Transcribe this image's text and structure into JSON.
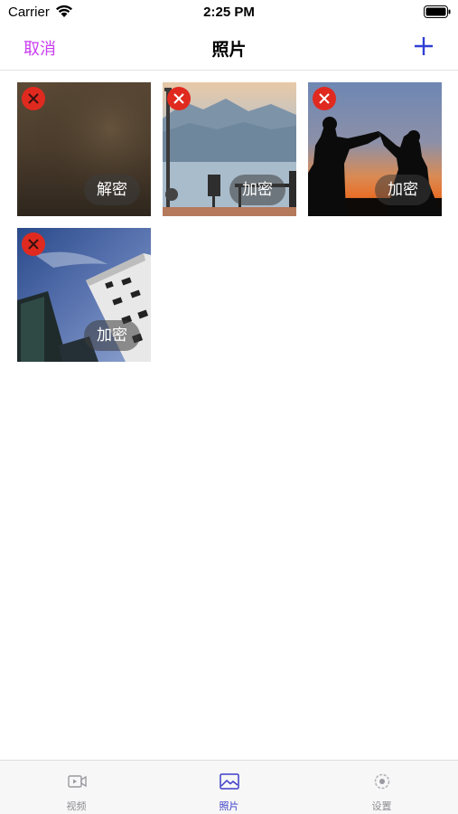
{
  "status_bar": {
    "carrier": "Carrier",
    "time": "2:25 PM"
  },
  "nav": {
    "cancel_label": "取消",
    "title": "照片",
    "accent_color": "#c93cf0",
    "add_color": "#2f3fd6"
  },
  "photos": [
    {
      "scene": "dark-brown-blur",
      "action_label": "解密"
    },
    {
      "scene": "mountain-lake-pier",
      "action_label": "加密"
    },
    {
      "scene": "sunset-silhouettes-heart",
      "action_label": "加密"
    },
    {
      "scene": "building-low-angle",
      "action_label": "加密"
    }
  ],
  "tabs": [
    {
      "label": "视频",
      "icon": "video-icon",
      "active": false
    },
    {
      "label": "照片",
      "icon": "photo-icon",
      "active": true
    },
    {
      "label": "设置",
      "icon": "settings-icon",
      "active": false
    }
  ]
}
